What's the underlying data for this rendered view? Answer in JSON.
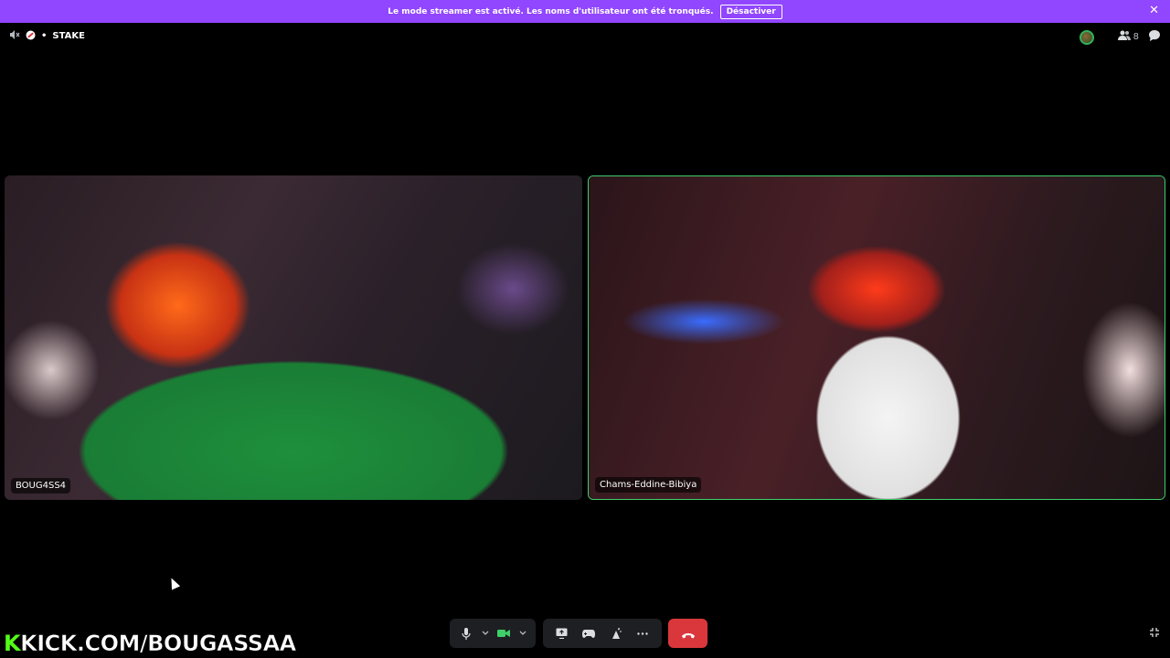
{
  "banner": {
    "message": "Le mode streamer est activé. Les noms d'utilisateur ont été tronqués.",
    "button_label": "Désactiver",
    "close_glyph": "✕"
  },
  "topbar": {
    "channel_prefix": "•",
    "channel_name": "STAKE",
    "participant_count": "8"
  },
  "tiles": [
    {
      "name": "BOUG4SS4"
    },
    {
      "name": "Chams-Eddine-Bibiya"
    }
  ],
  "overlay": {
    "kick_k": "K",
    "kick_url": "KICK.COM/BOUGASSAA"
  },
  "colors": {
    "banner": "#9146ff",
    "speaking_border": "#3fcf6a",
    "hangup": "#da373c",
    "kick_green": "#53fc18"
  },
  "icons": [
    "volume-icon",
    "no-entry-icon",
    "avatar-icon",
    "users-icon",
    "chat-icon",
    "mic-icon",
    "chevron-down-icon",
    "camera-icon",
    "screen-share-icon",
    "gamepad-icon",
    "soundboard-icon",
    "more-icon",
    "hangup-icon",
    "fullscreen-icon",
    "close-icon"
  ]
}
